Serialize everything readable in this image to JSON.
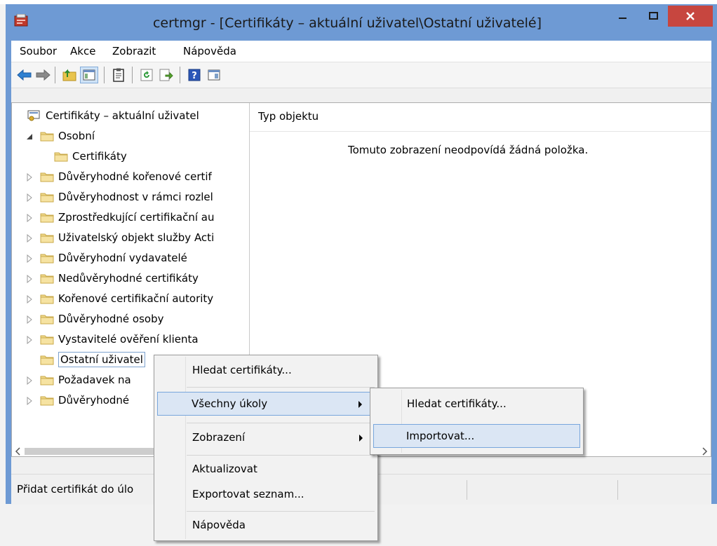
{
  "window": {
    "title": "certmgr - [Certifikáty – aktuální uživatel\\Ostatní uživatelé]"
  },
  "menubar": {
    "items": [
      "Soubor",
      "Akce",
      "Zobrazit",
      "Nápověda"
    ]
  },
  "toolbar": {
    "buttons": [
      "back-arrow-icon",
      "forward-arrow-icon",
      "up-folder-icon",
      "show-hide-tree-icon",
      "clipboard-icon",
      "refresh-icon",
      "export-list-icon",
      "help-icon",
      "console-tree-icon"
    ]
  },
  "tree": {
    "root": "Certifikáty – aktuální uživatel",
    "items": [
      "Osobní",
      "Certifikáty",
      "Důvěryhodné kořenové certif",
      "Důvěryhodnost v rámci rozlel",
      "Zprostředkující certifikační au",
      "Uživatelský objekt služby Acti",
      "Důvěryhodní vydavatelé",
      "Nedůvěryhodné certifikáty",
      "Kořenové certifikační autority",
      "Důvěryhodné osoby",
      "Vystavitelé ověření klienta",
      "Ostatní uživatel",
      "Požadavek na",
      "Důvěryhodné"
    ]
  },
  "list": {
    "column_header": "Typ objektu",
    "empty_message": "Tomuto zobrazení neodpovídá žádná položka."
  },
  "statusbar": {
    "text": "Přidat certifikát do úlo"
  },
  "context_menu": {
    "items": [
      "Hledat certifikáty...",
      "Všechny úkoly",
      "Zobrazení",
      "Aktualizovat",
      "Exportovat seznam...",
      "Nápověda"
    ]
  },
  "submenu": {
    "items": [
      "Hledat certifikáty...",
      "Importovat..."
    ]
  },
  "colors": {
    "title_bar": "#6e9ad4",
    "close_button": "#c7463f",
    "highlight": "#dbe6f4",
    "highlight_border": "#78a6dc",
    "folder": "#f0d98a"
  }
}
